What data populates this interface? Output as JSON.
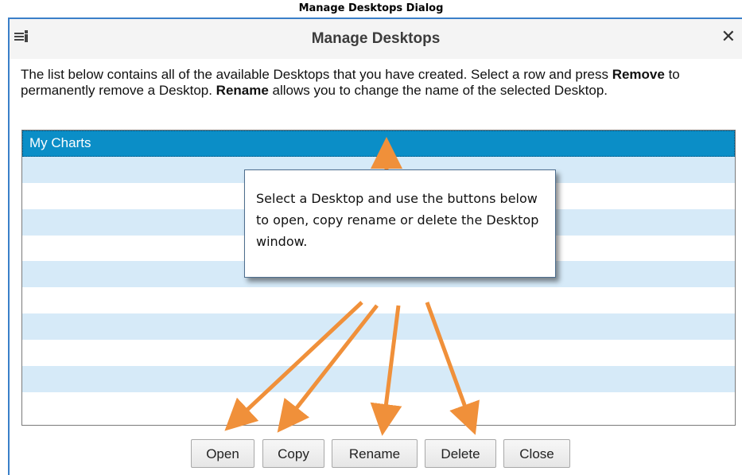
{
  "caption": "Manage Desktops Dialog",
  "dialog": {
    "title": "Manage Desktops",
    "close_glyph": "✕",
    "description": {
      "part1": "The list below contains all of the available Desktops that you have created.  Select a row and press ",
      "bold1": "Remove",
      "part2": " to permanently remove a Desktop.  ",
      "bold2": "Rename",
      "part3": " allows you to change the name of the selected Desktop."
    },
    "list": {
      "rows": [
        "My Charts",
        "",
        "",
        "",
        "",
        "",
        "",
        "",
        "",
        "",
        ""
      ],
      "selected_index": 0
    },
    "buttons": {
      "open": "Open",
      "copy": "Copy",
      "rename": "Rename",
      "delete": "Delete",
      "close": "Close"
    }
  },
  "callout": {
    "text": "Select a Desktop and use the buttons below to open, copy rename or delete the Desktop window."
  },
  "colors": {
    "selected_row": "#0b8ec7",
    "alt_row": "#d6eaf8",
    "arrow": "#f0903a",
    "dialog_border": "#3a7fc9"
  },
  "icons": {
    "title_icon": "desktop-stack-icon",
    "close_icon": "close-icon"
  }
}
